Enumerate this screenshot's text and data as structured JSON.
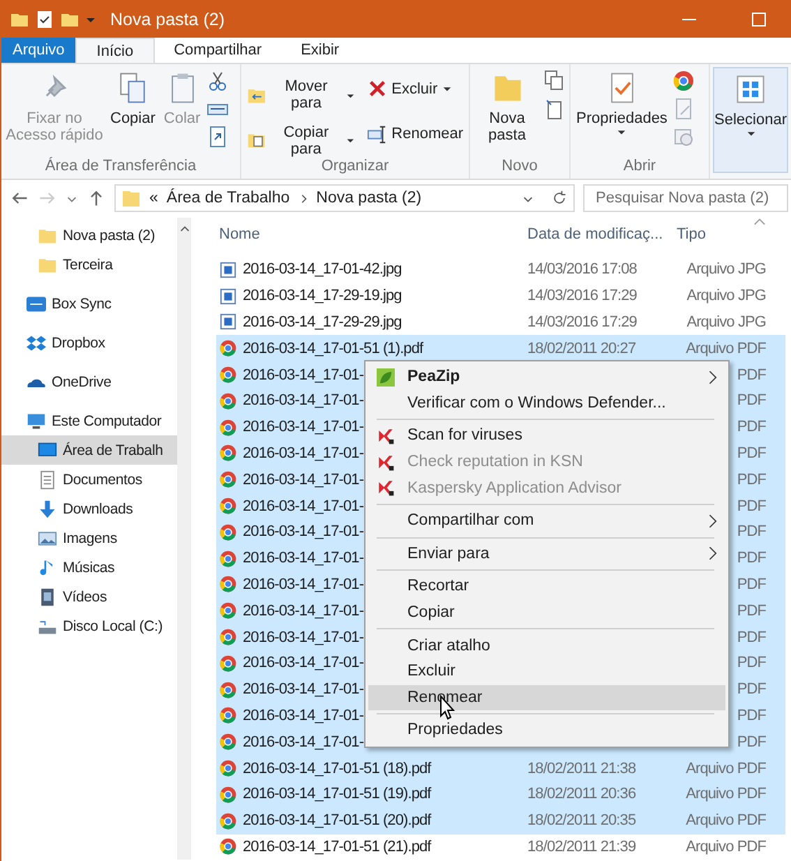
{
  "window": {
    "title": "Nova pasta (2)"
  },
  "ribbon_tabs": [
    {
      "label": "Arquivo",
      "kind": "file",
      "selected": false
    },
    {
      "label": "Início",
      "kind": "tab",
      "selected": true
    },
    {
      "label": "Compartilhar",
      "kind": "tab",
      "selected": false
    },
    {
      "label": "Exibir",
      "kind": "tab",
      "selected": false
    }
  ],
  "clipboard": {
    "title": "Área de Transferência",
    "buttons": [
      {
        "label": "Fixar no Acesso rápido",
        "kind": "pin",
        "disabled": true
      },
      {
        "label": "Copiar",
        "kind": "copy",
        "disabled": false
      },
      {
        "label": "Colar",
        "kind": "paste",
        "disabled": true
      }
    ]
  },
  "organize": {
    "title": "Organizar",
    "buttons": [
      {
        "label": "Mover para",
        "kind": "move",
        "dropdown": true
      },
      {
        "label": "Excluir",
        "kind": "delete",
        "dropdown": true
      },
      {
        "label": "Copiar para",
        "kind": "copyto",
        "dropdown": true
      },
      {
        "label": "Renomear",
        "kind": "rename",
        "dropdown": false
      }
    ]
  },
  "new": {
    "title": "Novo",
    "button": "Nova pasta"
  },
  "open": {
    "title": "Abrir",
    "button": "Propriedades"
  },
  "select": {
    "button": "Selecionar"
  },
  "address": {
    "overflow": "«",
    "crumbs": [
      "Área de Trabalho",
      "Nova pasta (2)"
    ]
  },
  "search": {
    "placeholder": "Pesquisar Nova pasta (2)"
  },
  "nav": [
    {
      "label": "Nova pasta (2)",
      "selected": false
    },
    {
      "label": "Terceira",
      "selected": false
    },
    {
      "label": "Box Sync",
      "selected": false
    },
    {
      "label": "Dropbox",
      "selected": false
    },
    {
      "label": "OneDrive",
      "selected": false
    },
    {
      "label": "Este Computador",
      "selected": false,
      "children": [
        {
          "label": "Área de Trabalh",
          "selected": true
        },
        {
          "label": "Documentos",
          "selected": false
        },
        {
          "label": "Downloads",
          "selected": false
        },
        {
          "label": "Imagens",
          "selected": false
        },
        {
          "label": "Músicas",
          "selected": false
        },
        {
          "label": "Vídeos",
          "selected": false
        },
        {
          "label": "Disco Local (C:)",
          "selected": false
        }
      ]
    }
  ],
  "columns": [
    "Nome",
    "Data de modificaç...",
    "Tipo"
  ],
  "rows": [
    {
      "name": "2016-03-14_17-01-42.jpg",
      "date": "14/03/2016 17:08",
      "type": "Arquivo JPG",
      "kind": "image",
      "selected": false
    },
    {
      "name": "2016-03-14_17-29-19.jpg",
      "date": "14/03/2016 17:29",
      "type": "Arquivo JPG",
      "kind": "image",
      "selected": false
    },
    {
      "name": "2016-03-14_17-29-29.jpg",
      "date": "14/03/2016 17:29",
      "type": "Arquivo JPG",
      "kind": "image",
      "selected": false
    },
    {
      "name": "2016-03-14_17-01-51 (1).pdf",
      "date": "18/02/2011 20:27",
      "type": "Arquivo PDF",
      "kind": "pdf",
      "selected": true
    },
    {
      "name": "2016-03-14_17-01-",
      "type": "PDF",
      "kind": "pdf",
      "selected": true
    },
    {
      "name": "2016-03-14_17-01-",
      "type": "PDF",
      "kind": "pdf",
      "selected": true
    },
    {
      "name": "2016-03-14_17-01-",
      "type": "PDF",
      "kind": "pdf",
      "selected": true
    },
    {
      "name": "2016-03-14_17-01-",
      "type": "PDF",
      "kind": "pdf",
      "selected": true
    },
    {
      "name": "2016-03-14_17-01-",
      "type": "PDF",
      "kind": "pdf",
      "selected": true
    },
    {
      "name": "2016-03-14_17-01-",
      "type": "PDF",
      "kind": "pdf",
      "selected": true
    },
    {
      "name": "2016-03-14_17-01-",
      "type": "PDF",
      "kind": "pdf",
      "selected": true
    },
    {
      "name": "2016-03-14_17-01-",
      "type": "PDF",
      "kind": "pdf",
      "selected": true
    },
    {
      "name": "2016-03-14_17-01-",
      "type": "PDF",
      "kind": "pdf",
      "selected": true
    },
    {
      "name": "2016-03-14_17-01-",
      "type": "PDF",
      "kind": "pdf",
      "selected": true
    },
    {
      "name": "2016-03-14_17-01-",
      "type": "PDF",
      "kind": "pdf",
      "selected": true
    },
    {
      "name": "2016-03-14_17-01-",
      "type": "PDF",
      "kind": "pdf",
      "selected": true
    },
    {
      "name": "2016-03-14_17-01-",
      "type": "PDF",
      "kind": "pdf",
      "selected": true
    },
    {
      "name": "2016-03-14_17-01-",
      "type": "PDF",
      "kind": "pdf",
      "selected": true
    },
    {
      "name": "2016-03-14_17-01-",
      "type": "PDF",
      "kind": "pdf",
      "selected": true
    },
    {
      "name": "2016-03-14_17-01-51 (18).pdf",
      "date": "18/02/2011 21:38",
      "type": "Arquivo PDF",
      "kind": "pdf",
      "selected": true
    },
    {
      "name": "2016-03-14_17-01-51 (19).pdf",
      "date": "18/02/2011 20:36",
      "type": "Arquivo PDF",
      "kind": "pdf",
      "selected": true
    },
    {
      "name": "2016-03-14_17-01-51 (20).pdf",
      "date": "18/02/2011 20:35",
      "type": "Arquivo PDF",
      "kind": "pdf",
      "selected": true
    },
    {
      "name": "2016-03-14_17-01-51 (21).pdf",
      "date": "18/02/2011 21:39",
      "type": "Arquivo PDF",
      "kind": "pdf",
      "selected": false
    }
  ],
  "context_menu": [
    {
      "kind": "peazip",
      "label": "PeaZip",
      "bold": true,
      "disabled": false,
      "submenu": true,
      "selected": false
    },
    {
      "kind": "item",
      "label": "Verificar com o Windows Defender...",
      "bold": false,
      "disabled": false,
      "submenu": false,
      "selected": false
    },
    {
      "kind": "separator"
    },
    {
      "kind": "kaspersky",
      "label": "Scan for viruses",
      "bold": false,
      "disabled": false,
      "submenu": false,
      "selected": false
    },
    {
      "kind": "kaspersky",
      "label": "Check reputation in KSN",
      "bold": false,
      "disabled": true,
      "submenu": false,
      "selected": false
    },
    {
      "kind": "kaspersky",
      "label": "Kaspersky Application Advisor",
      "bold": false,
      "disabled": true,
      "submenu": false,
      "selected": false
    },
    {
      "kind": "separator"
    },
    {
      "kind": "item",
      "label": "Compartilhar com",
      "bold": false,
      "disabled": false,
      "submenu": true,
      "selected": false
    },
    {
      "kind": "separator"
    },
    {
      "kind": "item",
      "label": "Enviar para",
      "bold": false,
      "disabled": false,
      "submenu": true,
      "selected": false
    },
    {
      "kind": "separator"
    },
    {
      "kind": "item",
      "label": "Recortar",
      "bold": false,
      "disabled": false,
      "submenu": false,
      "selected": false
    },
    {
      "kind": "item",
      "label": "Copiar",
      "bold": false,
      "disabled": false,
      "submenu": false,
      "selected": false
    },
    {
      "kind": "separator"
    },
    {
      "kind": "item",
      "label": "Criar atalho",
      "bold": false,
      "disabled": false,
      "submenu": false,
      "selected": false
    },
    {
      "kind": "item",
      "label": "Excluir",
      "bold": false,
      "disabled": false,
      "submenu": false,
      "selected": false
    },
    {
      "kind": "item",
      "label": "Renomear",
      "bold": false,
      "disabled": false,
      "submenu": false,
      "selected": true
    },
    {
      "kind": "separator"
    },
    {
      "kind": "item",
      "label": "Propriedades",
      "bold": false,
      "disabled": false,
      "submenu": false,
      "selected": false
    }
  ]
}
